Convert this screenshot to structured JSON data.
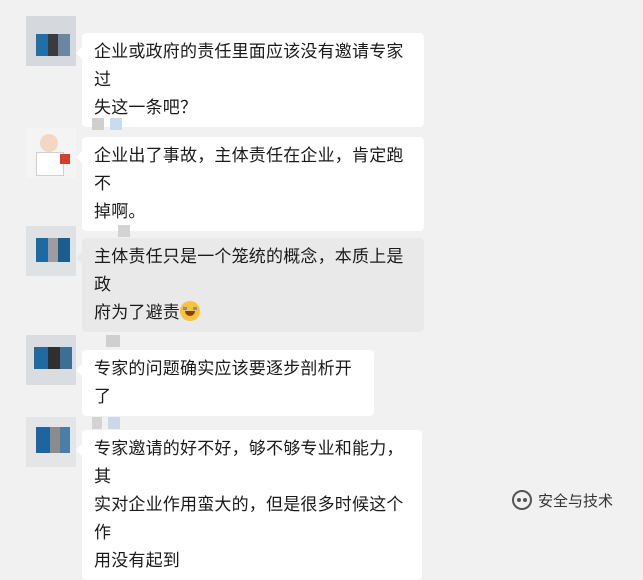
{
  "chat": {
    "messages": [
      {
        "text_lines": [
          "企业或政府的责任里面应该没有邀请专家过",
          "失这一条吧？"
        ],
        "style": "white",
        "avatar": "blurred-avatar"
      },
      {
        "text_lines": [
          "企业出了事故，主体责任在企业，肯定跑不",
          "掉啊。"
        ],
        "style": "white",
        "avatar": "doctor-cartoon-avatar"
      },
      {
        "text_lines": [
          "主体责任只是一个笼统的概念，本质上是政",
          "府为了避责"
        ],
        "style": "grey",
        "avatar": "blurred-avatar",
        "emoji": "laugh-cry-emoji"
      },
      {
        "text_lines": [
          "专家的问题确实应该要逐步剖析开了"
        ],
        "style": "white",
        "avatar": "blurred-avatar"
      },
      {
        "text_lines": [
          "专家邀请的好不好，够不够专业和能力，其",
          "实对企业作用蛮大的，但是很多时候这个作",
          "用没有起到"
        ],
        "style": "white",
        "avatar": "blurred-avatar"
      }
    ]
  },
  "watermark": {
    "text": "安全与技术",
    "icon": "wechat-icon"
  },
  "colors": {
    "background": "#f1f1f1",
    "bubble": "#ffffff",
    "bubble_highlight": "#e9e9e9",
    "text": "#1a1a1a"
  }
}
